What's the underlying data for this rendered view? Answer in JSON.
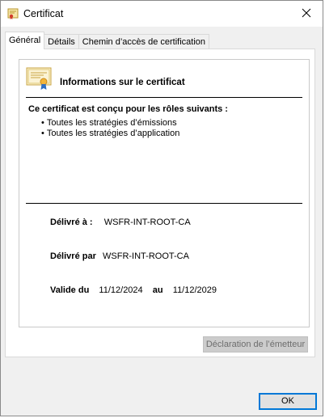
{
  "window": {
    "title": "Certificat"
  },
  "tabs": [
    {
      "label": "Général"
    },
    {
      "label": "Détails"
    },
    {
      "label": "Chemin d’accès de certification"
    }
  ],
  "general": {
    "heading": "Informations sur le certificat",
    "purpose_heading": "Ce certificat est conçu pour les rôles suivants :",
    "purposes": [
      "Toutes les stratégies d’émissions",
      "Toutes les stratégies d’application"
    ],
    "issued_to_label": "Délivré à :",
    "issued_to_value": "WSFR-INT-ROOT-CA",
    "issued_by_label": "Délivré par",
    "issued_by_value": "WSFR-INT-ROOT-CA",
    "valid_from_label": "Valide du",
    "valid_from_value": "11/12/2024",
    "valid_to_label": "au",
    "valid_to_value": "11/12/2029",
    "issuer_statement_button": "Déclaration de l’émetteur"
  },
  "footer": {
    "ok_label": "OK"
  },
  "icons": {
    "title": "certificate-icon",
    "close": "close-icon",
    "info": "certificate-ribbon-icon"
  }
}
